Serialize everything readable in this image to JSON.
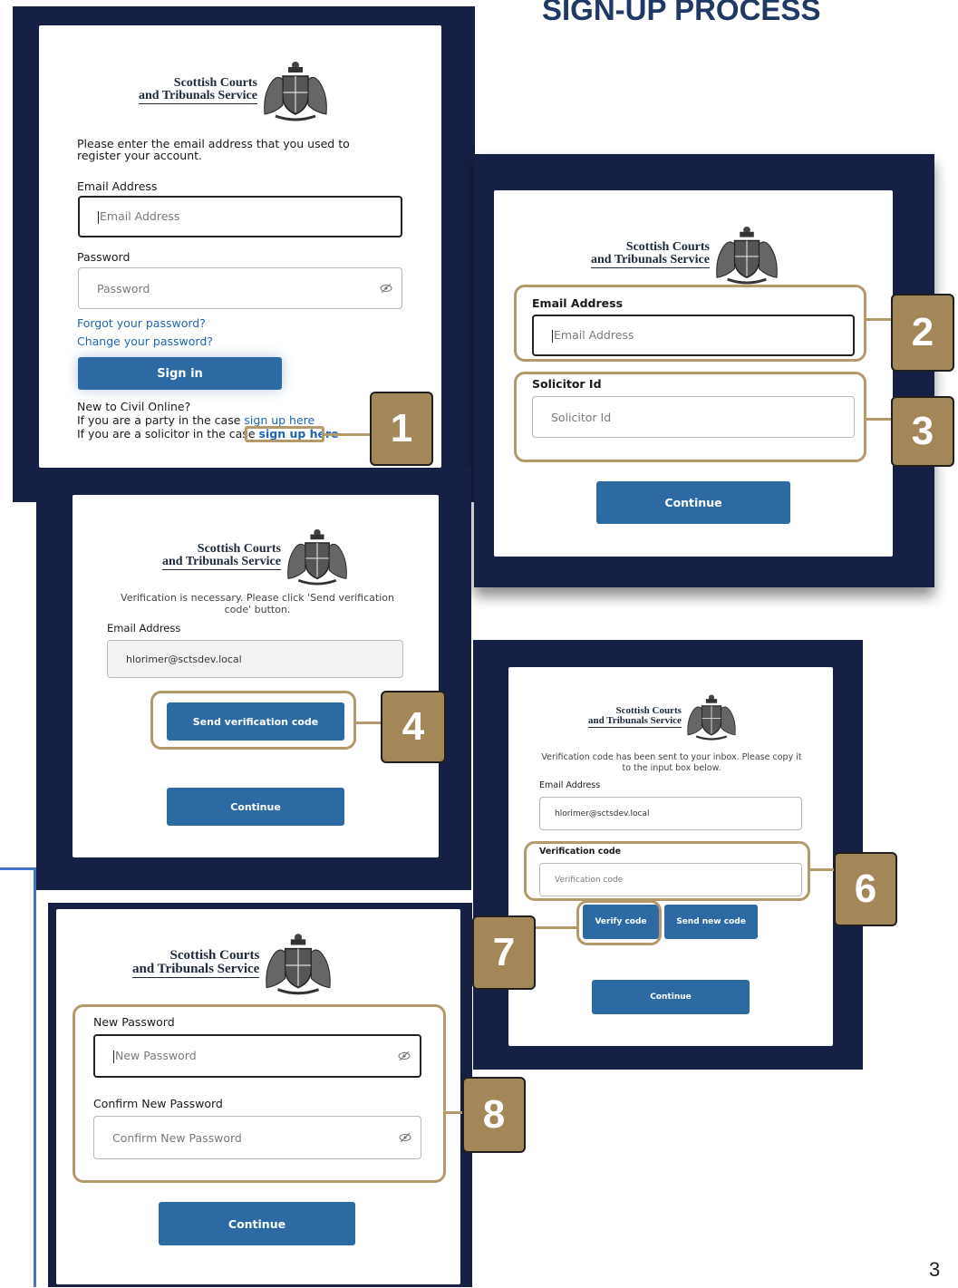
{
  "title": "SIGN-UP PROCESS",
  "page_number": "3",
  "brand": {
    "line1": "Scottish Courts",
    "line2": "and Tribunals Service"
  },
  "screen1": {
    "intro": "Please enter the email address that you used to register your account.",
    "email_label": "Email Address",
    "email_placeholder": "Email Address",
    "password_label": "Password",
    "password_placeholder": "Password",
    "forgot_link": "Forgot your password?",
    "change_link": "Change your password?",
    "sign_in": "Sign in",
    "new_prompt": "New to Civil Online?",
    "party_text": "If you are a party in the case",
    "party_link": "sign up here",
    "solicitor_text": "If you are a solicitor in the case",
    "solicitor_link": "sign up here"
  },
  "screen2": {
    "email_label": "Email Address",
    "email_placeholder": "Email Address",
    "solicitor_label": "Solicitor Id",
    "solicitor_placeholder": "Solicitor Id",
    "continue": "Continue"
  },
  "screen3": {
    "message": "Verification is necessary. Please click 'Send verification code' button.",
    "email_label": "Email Address",
    "email_value": "hlorimer@sctsdev.local",
    "send_code": "Send verification code",
    "continue": "Continue"
  },
  "screen4": {
    "message": "Verification code has been sent to your inbox. Please copy it to the input box below.",
    "email_label": "Email Address",
    "email_value": "hlorimer@sctsdev.local",
    "code_label": "Verification code",
    "code_placeholder": "Verification code",
    "verify": "Verify code",
    "send_new": "Send new code",
    "continue": "Continue"
  },
  "screen5": {
    "new_label": "New Password",
    "new_placeholder": "New Password",
    "confirm_label": "Confirm New Password",
    "confirm_placeholder": "Confirm New Password",
    "continue": "Continue"
  },
  "callouts": {
    "c1": "1",
    "c2": "2",
    "c3": "3",
    "c4": "4",
    "c6": "6",
    "c7": "7",
    "c8": "8"
  },
  "colors": {
    "navy_panel": "#162044",
    "button_blue": "#2d6aa3",
    "gold": "#a38758",
    "link_blue": "#1f64b4",
    "title_blue": "#1f3864"
  },
  "icons": [
    "crest-icon",
    "eye-off-icon"
  ]
}
